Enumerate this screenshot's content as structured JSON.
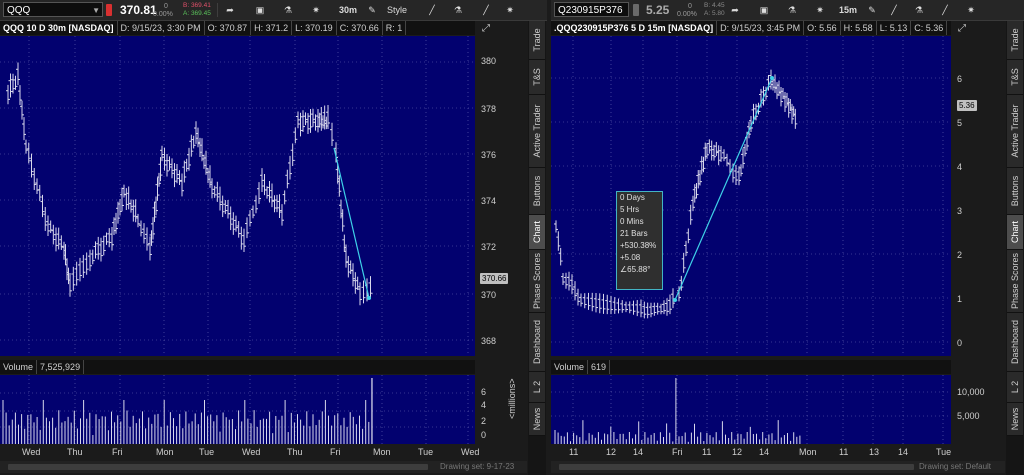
{
  "left": {
    "symbol": "QQQ",
    "last": "370.81",
    "change_top": "0",
    "change_bottom": "0.00%",
    "bid": "B: 369.41",
    "ask": "A: 369.45",
    "aggregation": "30m",
    "style_label": "Style",
    "info": {
      "title": "QQQ 10 D 30m [NASDAQ]",
      "date": "D: 9/15/23, 3:30 PM",
      "open": "O: 370.87",
      "high": "H: 371.2",
      "low": "L: 370.19",
      "close": "C: 370.66",
      "range": "R: 1"
    },
    "price_ticks": [
      "380",
      "378",
      "376",
      "374",
      "372",
      "370",
      "368"
    ],
    "price_tag": "370.66",
    "volume_label": "Volume",
    "volume_value": "7,525,929",
    "volume_ticks": [
      "6",
      "4",
      "2",
      "0"
    ],
    "volume_unit": "<millions>",
    "x_labels": [
      "Wed",
      "Thu",
      "Fri",
      "Mon",
      "Tue",
      "Wed",
      "Thu",
      "Fri",
      "Mon",
      "Tue",
      "Wed"
    ],
    "drawing_set": "Drawing set: 9-17-23"
  },
  "right": {
    "symbol": "Q230915P376",
    "last": "5.25",
    "change_top": "0",
    "change_bottom": "0.00%",
    "bid": "B: 4.45",
    "ask": "A: 5.80",
    "aggregation": "15m",
    "info": {
      "title": ".QQQ230915P376 5 D 15m [NASDAQ]",
      "date": "D: 9/15/23, 3:45 PM",
      "open": "O: 5.56",
      "high": "H: 5.58",
      "low": "L: 5.13",
      "close": "C: 5.36"
    },
    "price_ticks": [
      "6",
      "5",
      "4",
      "3",
      "2",
      "1",
      "0"
    ],
    "price_tag": "5.36",
    "volume_label": "Volume",
    "volume_value": "619",
    "volume_ticks": [
      "10,000",
      "5,000"
    ],
    "x_labels": [
      "11",
      "12",
      "14",
      "Fri",
      "11",
      "12",
      "14",
      "Mon",
      "11",
      "13",
      "14",
      "Tue"
    ],
    "drawing_set": "Drawing set: Default",
    "tooltip": [
      "0 Days",
      "5 Hrs",
      "0 Mins",
      "21 Bars",
      "+530.38%",
      "+5.08",
      "∠65.88°"
    ]
  },
  "side_tabs_left": [
    "Trade",
    "T&S",
    "Active Trader",
    "Buttons",
    "Chart",
    "Phase Scores",
    "Dashboard",
    "L 2",
    "News"
  ],
  "side_tabs_right": [
    "Trade",
    "T&S",
    "Active Trader",
    "Buttons",
    "Chart",
    "Phase Scores",
    "Dashboard",
    "L 2",
    "News"
  ],
  "colors": {
    "plot_bg": "#02016f",
    "trendline": "#3fd1e8",
    "bars": "#d8d8ec",
    "grid": "#6a6ab6"
  }
}
